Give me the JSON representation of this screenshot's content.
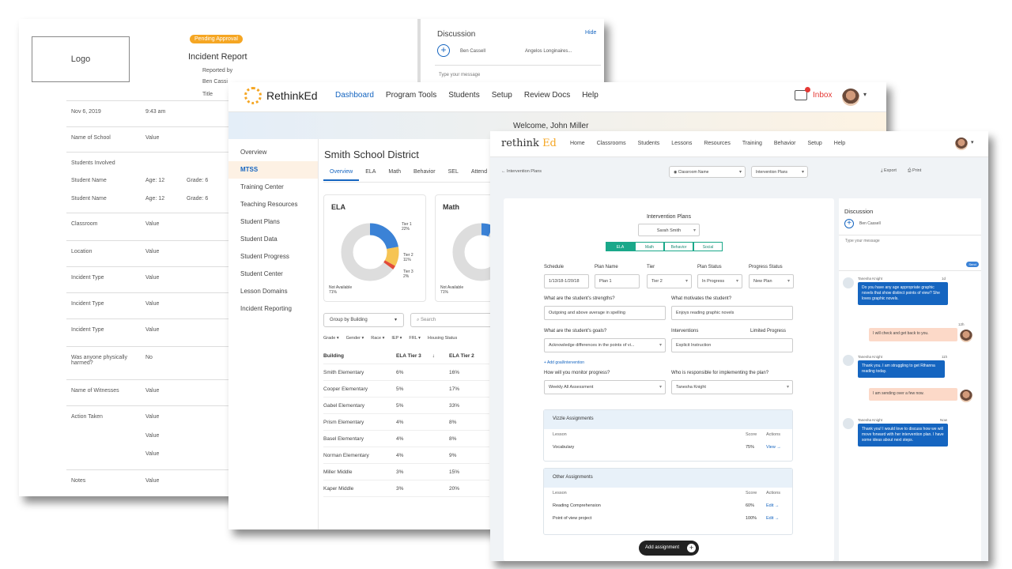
{
  "incident_report": {
    "logo_label": "Logo",
    "status_badge": "Pending Approval",
    "title": "Incident Report",
    "reported_by_label": "Reported by",
    "reported_by_value": "Ben Cassi",
    "title_label": "Title",
    "rows": [
      {
        "label": "Nov 6, 2019",
        "col1": "9:43 am",
        "col2": ""
      },
      {
        "label": "Name of School",
        "col1": "Value",
        "col2": ""
      },
      {
        "label": "Students Involved",
        "col1": "",
        "col2": ""
      },
      {
        "label": "Student Name",
        "col1": "Age: 12",
        "col2": "Grade: 6"
      },
      {
        "label": "Student Name",
        "col1": "Age: 12",
        "col2": "Grade: 6"
      },
      {
        "label": "Classroom",
        "col1": "Value",
        "col2": ""
      },
      {
        "label": "Location",
        "col1": "Value",
        "col2": ""
      },
      {
        "label": "Incident Type",
        "col1": "Value",
        "col2": ""
      },
      {
        "label": "Incident Type",
        "col1": "Value",
        "col2": ""
      },
      {
        "label": "Incident Type",
        "col1": "Value",
        "col2": ""
      },
      {
        "label": "Was anyone physically harmed?",
        "col1": "No",
        "col2": ""
      },
      {
        "label": "Name of Witnesses",
        "col1": "Value",
        "col2": ""
      },
      {
        "label": "Action Taken",
        "col1": "Value",
        "col2": ""
      },
      {
        "label": "",
        "col1": "Value",
        "col2": ""
      },
      {
        "label": "",
        "col1": "Value",
        "col2": ""
      },
      {
        "label": "Notes",
        "col1": "Value",
        "col2": ""
      }
    ],
    "discussion": {
      "title": "Discussion",
      "hide": "Hide",
      "participant1": "Ben Cassell",
      "participant2": "Angelos Longinaires...",
      "placeholder": "Type your message"
    }
  },
  "dashboard": {
    "brand": "RethinkEd",
    "nav": [
      "Dashboard",
      "Program Tools",
      "Students",
      "Setup",
      "Review Docs",
      "Help"
    ],
    "inbox": "Inbox",
    "welcome": "Welcome, John Miller",
    "sidebar": [
      "Overview",
      "MTSS",
      "Training Center",
      "Teaching Resources",
      "Student Plans",
      "Student Data",
      "Student Progress",
      "Student Center",
      "Lesson Domains",
      "Incident Reporting"
    ],
    "district": "Smith School District",
    "tabs": [
      "Overview",
      "ELA",
      "Math",
      "Behavior",
      "SEL",
      "Attend"
    ],
    "cards": [
      {
        "title": "ELA",
        "labels": [
          "Tier 1",
          "22%",
          "Tier 2",
          "11%",
          "Tier 3",
          "2%",
          "Not Available",
          "71%"
        ]
      },
      {
        "title": "Math",
        "labels": [
          "Not Available",
          "71%"
        ]
      }
    ],
    "group_by": "Group by Building",
    "search": "Search",
    "filters": [
      "Grade ▾",
      "Gender ▾",
      "Race ▾",
      "IEP ▾",
      "FRL ▾",
      "Housing Status"
    ],
    "table_headers": [
      "Building",
      "ELA Tier 3",
      "ELA Tier 2"
    ],
    "table_rows": [
      [
        "Smith Elementary",
        "6%",
        "16%"
      ],
      [
        "Cooper Elementary",
        "5%",
        "17%"
      ],
      [
        "Gabel Elementary",
        "5%",
        "33%"
      ],
      [
        "Prism Elementary",
        "4%",
        "8%"
      ],
      [
        "Basel Elementary",
        "4%",
        "8%"
      ],
      [
        "Norman Elementary",
        "4%",
        "9%"
      ],
      [
        "Miller Middle",
        "3%",
        "15%"
      ],
      [
        "Kaper Middle",
        "3%",
        "20%"
      ]
    ]
  },
  "plans": {
    "brand_a": "rethink",
    "brand_b": "Ed",
    "nav": [
      "Home",
      "Classrooms",
      "Students",
      "Lessons",
      "Resources",
      "Training",
      "Behavior",
      "Setup",
      "Help"
    ],
    "back": "Intervention Plans",
    "classroom_select": "Classroom Name",
    "plans_select": "Intervention Plans",
    "export": "Export",
    "print": "Print",
    "form_title": "Intervention Plans",
    "student_select": "Sarah Smith",
    "subject_tabs": [
      "ELA",
      "Math",
      "Behavior",
      "Social"
    ],
    "schedule_label": "Schedule",
    "schedule_value": "1/13/18-1/20/18",
    "plan_name_label": "Plan Name",
    "plan_name_value": "Plan 1",
    "tier_label": "Tier",
    "tier_value": "Tier 2",
    "plan_status_label": "Plan Status",
    "plan_status_value": "In Progress",
    "progress_status_label": "Progress Status",
    "progress_status_value": "New Plan",
    "strengths_label": "What are the student's strengths?",
    "strengths_value": "Outgoing and above average in spelling",
    "motivates_label": "What motivates the student?",
    "motivates_value": "Enjoys reading graphic novels",
    "goals_label": "What are the student's goals?",
    "goals_value": "Acknowledge differences in the points of vi...",
    "interventions_label": "Interventions",
    "interventions_extra": "Limited Progress",
    "interventions_value": "Explicit Instruction",
    "add_goal": "+ Add goal/intervention",
    "monitor_label": "How will you monitor progress?",
    "monitor_value": "Weekly All Assessment",
    "responsible_label": "Who is responsible for implementing the plan?",
    "responsible_value": "Tanesha Knight",
    "vizzle": {
      "title": "Vizzle Assignments",
      "col_lesson": "Lesson",
      "col_score": "Score",
      "col_actions": "Actions",
      "rows": [
        {
          "lesson": "Vocabulary",
          "score": "75%",
          "action": "View →"
        }
      ]
    },
    "other": {
      "title": "Other Assignments",
      "col_lesson": "Lesson",
      "col_score": "Score",
      "col_actions": "Actions",
      "rows": [
        {
          "lesson": "Reading Comprehension",
          "score": "60%",
          "action": "Edit →"
        },
        {
          "lesson": "Point of view project",
          "score": "100%",
          "action": "Edit →"
        }
      ]
    },
    "add_assignment": "Add assignment",
    "discussion": {
      "title": "Discussion",
      "participant": "Ben Cassell",
      "placeholder": "Type your message",
      "send": "Send",
      "messages": [
        {
          "name": "Tanesha Knight",
          "date": "1d",
          "text": "Do you have any age appropriate graphic novels that show distinct points of view? She loves graphic novels."
        },
        {
          "date": "12h",
          "text": "I will check and get back to you."
        },
        {
          "name": "Tanesha Knight",
          "date": "11h",
          "text": "Thank you. I am struggling to get Rihanna reading today."
        },
        {
          "date": "",
          "text": "I am sending over a few now."
        },
        {
          "name": "Tanesha Knight",
          "date": "Now",
          "text": "Thank you! I would love to discuss how we will move forward with her intervention plan. I have some ideas about next steps."
        }
      ]
    }
  },
  "colors": {
    "accent_blue": "#1565c0",
    "accent_orange": "#f5a623",
    "teal": "#1aa88a",
    "inbox_red": "#e53935"
  }
}
